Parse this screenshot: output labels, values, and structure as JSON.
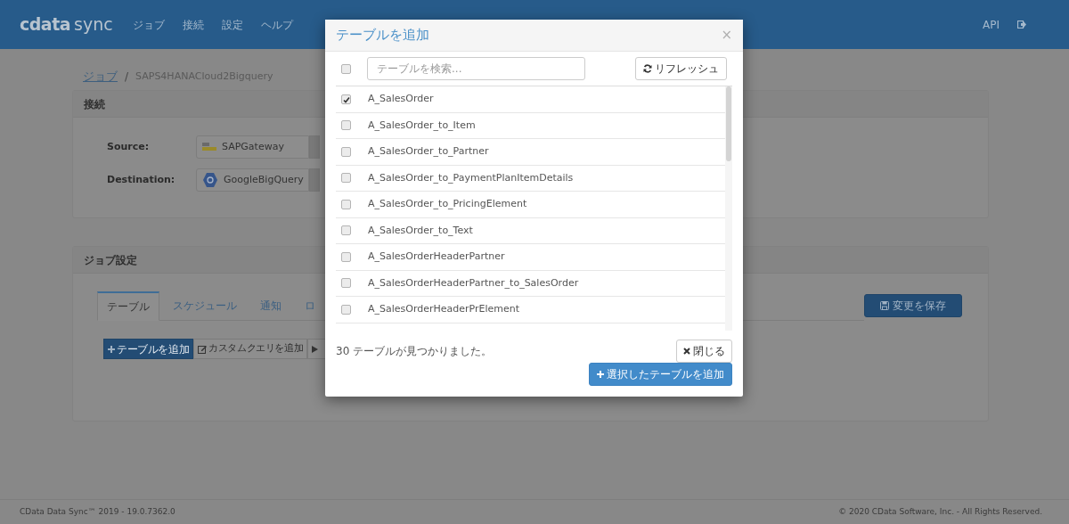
{
  "navbar": {
    "brand_main": "cdata",
    "brand_sub": "sync",
    "menu": [
      "ジョブ",
      "接続",
      "設定",
      "ヘルプ"
    ],
    "api": "API"
  },
  "breadcrumb": [
    "ジョブ",
    "/",
    "SAPS4HANACloud2Bigquery"
  ],
  "connection_panel": {
    "title": "接続",
    "fields": [
      {
        "label": "Source:",
        "value": "SAPGateway",
        "kind": "sap"
      },
      {
        "label": "Destination:",
        "value": "GoogleBigQuery",
        "kind": "bigquery"
      }
    ]
  },
  "job_panel": {
    "title": "ジョブ設定",
    "tabs": [
      {
        "label": "テーブル",
        "selected": true
      },
      {
        "label": "スケジュール",
        "selected": false
      },
      {
        "label": "通知",
        "selected": false
      },
      {
        "label": "ロ",
        "selected": false
      }
    ],
    "buttons": [
      {
        "kind": "add",
        "label": "テーブルを追加"
      },
      {
        "kind": "query",
        "label": "カスタムクエリを追加"
      },
      {
        "kind": "run"
      }
    ],
    "save": "変更を保存"
  },
  "modal": {
    "title": "テーブルを追加",
    "close_glyph": "×",
    "select_all": false,
    "search": {
      "placeholder": "テーブルを検索..."
    },
    "refresh": "リフレッシュ",
    "tables": [
      {
        "name": "A_SalesOrder",
        "checked": true
      },
      {
        "name": "A_SalesOrder_to_Item",
        "checked": false
      },
      {
        "name": "A_SalesOrder_to_Partner",
        "checked": false
      },
      {
        "name": "A_SalesOrder_to_PaymentPlanItemDetails",
        "checked": false
      },
      {
        "name": "A_SalesOrder_to_PricingElement",
        "checked": false
      },
      {
        "name": "A_SalesOrder_to_Text",
        "checked": false
      },
      {
        "name": "A_SalesOrderHeaderPartner",
        "checked": false
      },
      {
        "name": "A_SalesOrderHeaderPartner_to_SalesOrder",
        "checked": false
      },
      {
        "name": "A_SalesOrderHeaderPrElement",
        "checked": false
      }
    ],
    "count": "30 テーブルが見つかりました。",
    "close": "閉じる",
    "add": "選択したテーブルを追加"
  },
  "footer": {
    "left": "CData Data Sync™ 2019 - 19.0.7362.0",
    "right": "© 2020 CData Software, Inc. - All Rights Reserved."
  }
}
